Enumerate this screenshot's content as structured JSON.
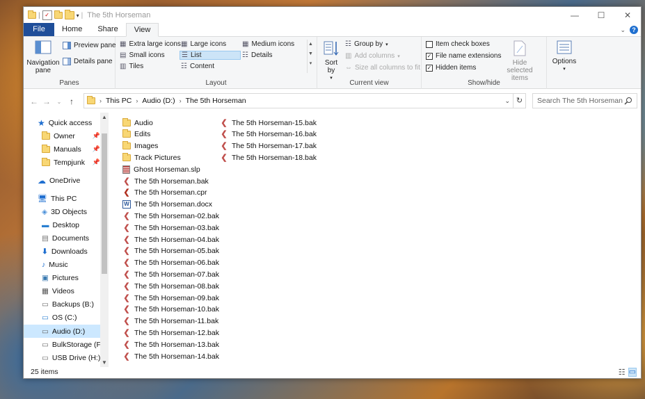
{
  "window": {
    "title": "The 5th Horseman"
  },
  "tabs": [
    {
      "label": "File"
    },
    {
      "label": "Home"
    },
    {
      "label": "Share"
    },
    {
      "label": "View"
    }
  ],
  "ribbon": {
    "panes": {
      "group_label": "Panes",
      "navigation_pane": "Navigation pane",
      "preview_pane": "Preview pane",
      "details_pane": "Details pane"
    },
    "layout": {
      "group_label": "Layout",
      "extra_large_icons": "Extra large icons",
      "large_icons": "Large icons",
      "medium_icons": "Medium icons",
      "small_icons": "Small icons",
      "list": "List",
      "details": "Details",
      "tiles": "Tiles",
      "content": "Content"
    },
    "current_view": {
      "group_label": "Current view",
      "sort_by": "Sort by",
      "group_by": "Group by",
      "add_columns": "Add columns",
      "size_all_columns": "Size all columns to fit"
    },
    "show_hide": {
      "group_label": "Show/hide",
      "item_check_boxes": "Item check boxes",
      "file_name_extensions": "File name extensions",
      "hidden_items": "Hidden items",
      "hide_selected_items": "Hide selected items",
      "item_check_boxes_checked": false,
      "file_name_extensions_checked": true,
      "hidden_items_checked": true
    },
    "options": {
      "label": "Options"
    }
  },
  "address": {
    "segments": [
      "This PC",
      "Audio (D:)",
      "The 5th Horseman"
    ],
    "search_placeholder": "Search The 5th Horseman"
  },
  "nav": {
    "quick_access": "Quick access",
    "quick_items": [
      "Owner",
      "Manuals",
      "Tempjunk"
    ],
    "onedrive": "OneDrive",
    "this_pc": "This PC",
    "pc_items": [
      "3D Objects",
      "Desktop",
      "Documents",
      "Downloads",
      "Music",
      "Pictures",
      "Videos",
      "Backups (B:)",
      "OS (C:)",
      "Audio (D:)",
      "BulkStorage (F:)",
      "USB Drive (H:)"
    ]
  },
  "files": [
    {
      "name": "Audio",
      "type": "folder"
    },
    {
      "name": "Edits",
      "type": "folder"
    },
    {
      "name": "Images",
      "type": "folder"
    },
    {
      "name": "Track Pictures",
      "type": "folder"
    },
    {
      "name": "Ghost Horseman.slp",
      "type": "slp"
    },
    {
      "name": "The 5th Horseman.bak",
      "type": "bak"
    },
    {
      "name": "The 5th Horseman.cpr",
      "type": "cpr"
    },
    {
      "name": "The 5th Horseman.docx",
      "type": "docx"
    },
    {
      "name": "The 5th Horseman-02.bak",
      "type": "bak"
    },
    {
      "name": "The 5th Horseman-03.bak",
      "type": "bak"
    },
    {
      "name": "The 5th Horseman-04.bak",
      "type": "bak"
    },
    {
      "name": "The 5th Horseman-05.bak",
      "type": "bak"
    },
    {
      "name": "The 5th Horseman-06.bak",
      "type": "bak"
    },
    {
      "name": "The 5th Horseman-07.bak",
      "type": "bak"
    },
    {
      "name": "The 5th Horseman-08.bak",
      "type": "bak"
    },
    {
      "name": "The 5th Horseman-09.bak",
      "type": "bak"
    },
    {
      "name": "The 5th Horseman-10.bak",
      "type": "bak"
    },
    {
      "name": "The 5th Horseman-11.bak",
      "type": "bak"
    },
    {
      "name": "The 5th Horseman-12.bak",
      "type": "bak"
    },
    {
      "name": "The 5th Horseman-13.bak",
      "type": "bak"
    },
    {
      "name": "The 5th Horseman-14.bak",
      "type": "bak"
    },
    {
      "name": "The 5th Horseman-15.bak",
      "type": "bak"
    },
    {
      "name": "The 5th Horseman-16.bak",
      "type": "bak"
    },
    {
      "name": "The 5th Horseman-17.bak",
      "type": "bak"
    },
    {
      "name": "The 5th Horseman-18.bak",
      "type": "bak"
    }
  ],
  "status": {
    "item_count": "25 items"
  },
  "colors": {
    "accent": "#1f4e99",
    "selection": "#cce8ff",
    "folder": "#f8d775",
    "bak_icon": "#c0504d"
  }
}
